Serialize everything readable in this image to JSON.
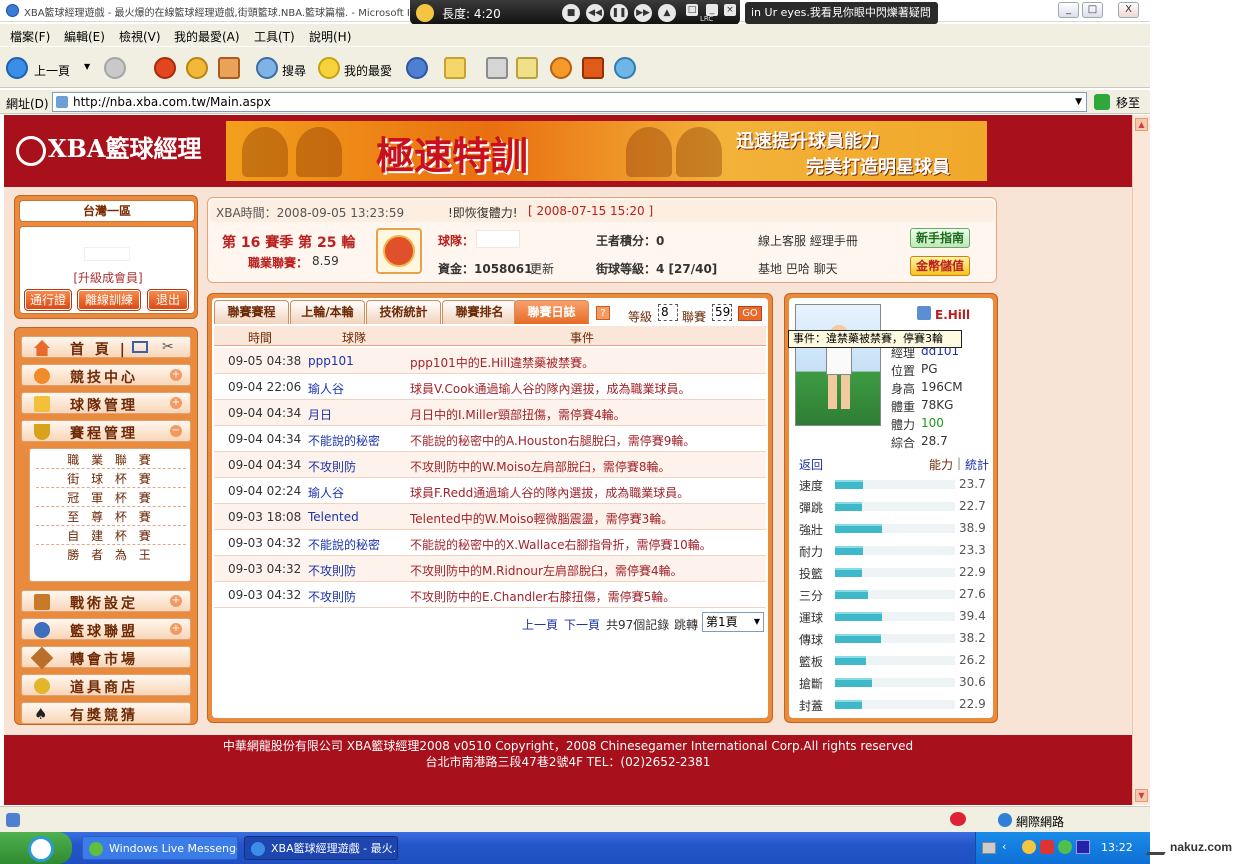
{
  "window": {
    "title": "XBA籃球經理遊戲 - 最火爆的在線籃球經理遊戲,街頭籃球.NBA.籃球篇檔. - Microsoft Internet Explorer",
    "minimize": "_",
    "maximize": "□",
    "close": "X"
  },
  "media_player": {
    "time": "長度: 4:20",
    "lyric": "in Ur eyes.我看見你眼中閃爍著疑問",
    "lrc": "LRC"
  },
  "menu": [
    "檔案(F)",
    "編輯(E)",
    "檢視(V)",
    "我的最愛(A)",
    "工具(T)",
    "說明(H)"
  ],
  "toolbar": {
    "back": "上一頁",
    "search": "搜尋",
    "favorites": "我的最愛"
  },
  "address": {
    "label": "網址(D)",
    "url": "http://nba.xba.com.tw/Main.aspx",
    "go": "移至"
  },
  "site": {
    "logo_text": "XBA籃球經理",
    "banner_big": "極速特訓",
    "banner_line1": "迅速提升球員能力",
    "banner_line2": "完美打造明星球員"
  },
  "login": {
    "server": "台灣一區",
    "upgrade": "[升級成會員]",
    "buttons": [
      "通行證",
      "離線訓練",
      "退出"
    ]
  },
  "nav": {
    "home": "首 頁 |",
    "items": [
      "競技中心",
      "球隊管理",
      "賽程管理",
      "戰術設定",
      "籃球聯盟",
      "轉會市場",
      "道具商店",
      "有獎競猜"
    ],
    "sub": [
      "職 業 聯 賽",
      "街 球 杯 賽",
      "冠 軍 杯 賽",
      "至 尊 杯 賽",
      "自 建 杯 賽",
      "勝 者 為 王"
    ]
  },
  "info": {
    "time_label": "XBA時間：2008-09-05 13:23:59",
    "restore": "!即恢復體力!",
    "restore_date": "[ 2008-07-15 15:20 ]",
    "season": "第 16 賽季 第 25 輪",
    "league_label": "職業聯賽：",
    "league_value": "8.59",
    "team_label": "球隊：",
    "king_label": "王者積分：0",
    "links1": "線上客服 經理手冊",
    "newbie": "新手指南",
    "funds_label": "資金：1058061",
    "refresh": "更新",
    "street_label": "街球等級：4 [27/40]",
    "links2": "基地 巴哈 聊天",
    "recharge": "金幣儲值"
  },
  "events": {
    "tabs": [
      "聯賽賽程",
      "上輪/本輪",
      "技術統計",
      "聯賽排名",
      "聯賽日誌"
    ],
    "help": "?",
    "level_label": "等級",
    "level_value": "8",
    "league_label": "聯賽",
    "league_value": "59",
    "go": "GO",
    "headers": [
      "時間",
      "球隊",
      "事件"
    ],
    "rows": [
      {
        "time": "09-05 04:38",
        "team": "ppp101",
        "event": "ppp101中的E.Hill違禁藥被禁賽。"
      },
      {
        "time": "09-04 22:06",
        "team": "瑜人谷",
        "event": "球員V.Cook通過瑜人谷的隊內選拔，成為職業球員。"
      },
      {
        "time": "09-04 04:34",
        "team": "月日",
        "event": "月日中的I.Miller頸部扭傷，需停賽4輪。"
      },
      {
        "time": "09-04 04:34",
        "team": "不能說的秘密",
        "event": "不能說的秘密中的A.Houston右腿脫臼，需停賽9輪。"
      },
      {
        "time": "09-04 04:34",
        "team": "不攻則防",
        "event": "不攻則防中的W.Moiso左肩部脫臼，需停賽8輪。"
      },
      {
        "time": "09-04 02:24",
        "team": "瑜人谷",
        "event": "球員F.Redd通過瑜人谷的隊內選拔，成為職業球員。"
      },
      {
        "time": "09-03 18:08",
        "team": "Telented",
        "event": "Telented中的W.Moiso輕微腦震盪，需停賽3輪。"
      },
      {
        "time": "09-03 04:32",
        "team": "不能說的秘密",
        "event": "不能說的秘密中的X.Wallace右腳指骨折，需停賽10輪。"
      },
      {
        "time": "09-03 04:32",
        "team": "不攻則防",
        "event": "不攻則防中的M.Ridnour左肩部脫臼，需停賽4輪。"
      },
      {
        "time": "09-03 04:32",
        "team": "不攻則防",
        "event": "不攻則防中的E.Chandler右膝扭傷，需停賽5輪。"
      }
    ],
    "pager": {
      "prev": "上一頁",
      "next": "下一頁",
      "total": "共97個記錄",
      "jump": "跳轉",
      "page": "第1頁"
    }
  },
  "player": {
    "name": "E.Hill",
    "tooltip": "事件：違禁藥被禁賽，停賽3輪",
    "manager_label": "經理",
    "manager": "dd101",
    "position_label": "位置",
    "position": "PG",
    "height_label": "身高",
    "height": "196CM",
    "weight_label": "體重",
    "weight": "78KG",
    "stamina_label": "體力",
    "stamina": "100",
    "overall_label": "綜合",
    "overall": "28.7",
    "back": "返回",
    "ability": "能力",
    "stats": "統計",
    "attrs": [
      {
        "name": "速度",
        "value": 23.7
      },
      {
        "name": "彈跳",
        "value": 22.7
      },
      {
        "name": "強壯",
        "value": 38.9
      },
      {
        "name": "耐力",
        "value": 23.3
      },
      {
        "name": "投籃",
        "value": 22.9
      },
      {
        "name": "三分",
        "value": 27.6
      },
      {
        "name": "運球",
        "value": 39.4
      },
      {
        "name": "傳球",
        "value": 38.2
      },
      {
        "name": "籃板",
        "value": 26.2
      },
      {
        "name": "搶斷",
        "value": 30.6
      },
      {
        "name": "封蓋",
        "value": 22.9
      }
    ]
  },
  "footer": {
    "line1": "中華網龍股份有限公司 XBA籃球經理2008 v0510     Copyright，2008 Chinesegamer International Corp.All rights reserved",
    "line2": "台北市南港路三段47巷2號4F TEL：(02)2652-2381"
  },
  "status": {
    "zone": "網際網路"
  },
  "taskbar": {
    "tasks": [
      "Windows Live Messenger",
      "XBA籃球經理遊戲 - 最火..."
    ],
    "clock": "13:22"
  },
  "watermark": "nakuz.com",
  "colors": {
    "brand_red": "#a8111c",
    "accent_orange": "#e98b3f",
    "bar_fill": "#3fb8c9"
  }
}
